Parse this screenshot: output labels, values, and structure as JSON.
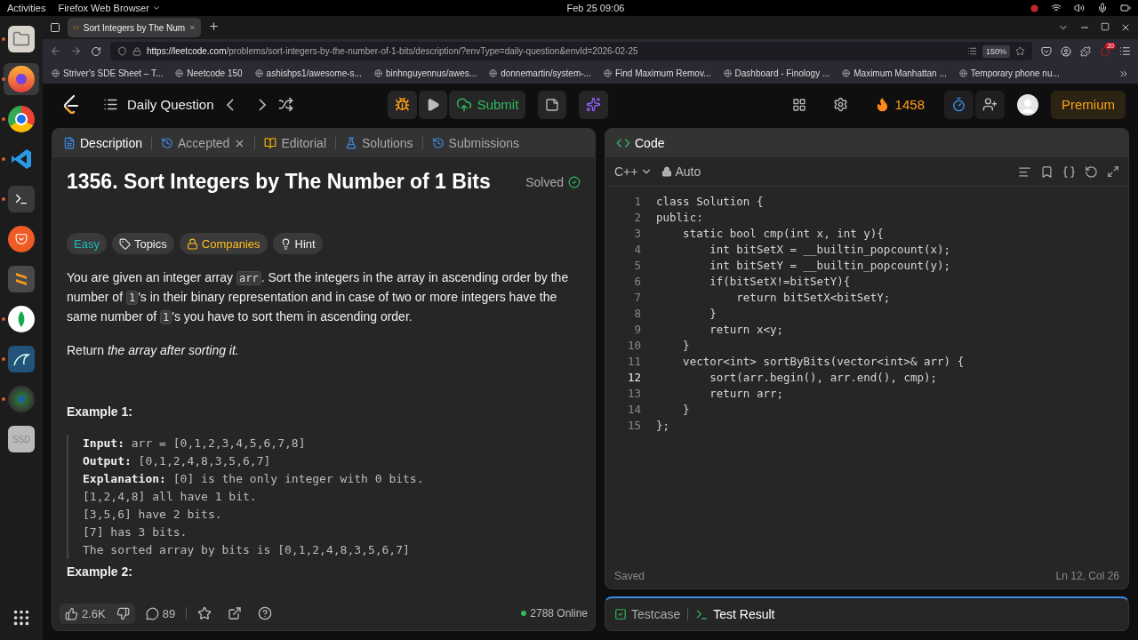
{
  "system_bar": {
    "activities": "Activities",
    "app_menu": "Firefox Web Browser",
    "clock": "Feb 25  09:06"
  },
  "dock": [
    {
      "kind": "files",
      "running": true,
      "selected": false
    },
    {
      "kind": "firefox",
      "running": true,
      "selected": true
    },
    {
      "kind": "chrome",
      "running": true,
      "selected": false
    },
    {
      "kind": "vscode",
      "running": true,
      "selected": false
    },
    {
      "kind": "terminal",
      "running": true,
      "selected": false
    },
    {
      "kind": "postman",
      "running": false,
      "selected": false
    },
    {
      "kind": "sublime",
      "running": false,
      "selected": false
    },
    {
      "kind": "mongodb",
      "running": true,
      "selected": false
    },
    {
      "kind": "mysql",
      "running": true,
      "selected": false
    },
    {
      "kind": "camera",
      "running": true,
      "selected": false
    },
    {
      "kind": "disk",
      "label": "SSD",
      "running": false,
      "selected": false
    }
  ],
  "browser": {
    "tab_title": "Sort Integers by The Num",
    "url_host": "https://leetcode.com",
    "url_path": "/problems/sort-integers-by-the-number-of-1-bits/description/?envType=daily-question&envId=2026-02-25",
    "zoom": "150%",
    "extension_badge": "20",
    "bookmarks": [
      "Striver's SDE Sheet – T...",
      "Neetcode 150",
      "ashishps1/awesome-s...",
      "binhnguyennus/awes...",
      "donnemartin/system-...",
      "Find Maximum Remov...",
      "Dashboard - Finology ...",
      "Maximum Manhattan ...",
      "Temporary phone nu..."
    ]
  },
  "header": {
    "title": "Daily Question",
    "submit": "Submit",
    "streak": "1458",
    "premium": "Premium"
  },
  "left_tabs": [
    {
      "label": "Description",
      "kind": "description",
      "selected": true
    },
    {
      "label": "Accepted",
      "kind": "accepted",
      "selected": false
    },
    {
      "label": "Editorial",
      "kind": "editorial",
      "selected": false
    },
    {
      "label": "Solutions",
      "kind": "solutions",
      "selected": false
    },
    {
      "label": "Submissions",
      "kind": "submissions",
      "selected": false
    }
  ],
  "problem": {
    "title": "1356. Sort Integers by The Number of 1 Bits",
    "status": "Solved",
    "tags": [
      {
        "label": "Easy",
        "kind": "difficulty"
      },
      {
        "label": "Topics",
        "kind": "topics"
      },
      {
        "label": "Companies",
        "kind": "companies"
      },
      {
        "label": "Hint",
        "kind": "hint"
      }
    ],
    "description": [
      {
        "kind": "text",
        "text": "You are given an integer array "
      },
      {
        "kind": "code",
        "text": "arr"
      },
      {
        "kind": "text",
        "text": ". Sort the integers in the array in ascending order by the number of "
      },
      {
        "kind": "code",
        "text": "1"
      },
      {
        "kind": "text",
        "text": "'s in their binary representation and in case of two or more integers have the same number of "
      },
      {
        "kind": "code",
        "text": "1"
      },
      {
        "kind": "text",
        "text": "'s you have to sort them in ascending order."
      }
    ],
    "return_text": "Return *the array after sorting it.*",
    "example_title": "Example 1:",
    "example_lines": [
      "**Input:** arr = [0,1,2,3,4,5,6,7,8]",
      "**Output:** [0,1,2,4,8,3,5,6,7]",
      "**Explanation:** [0] is the only integer with 0 bits.",
      "[1,2,4,8] all have 1 bit.",
      "[3,5,6] have 2 bits.",
      "[7] has 3 bits.",
      "The sorted array by bits is [0,1,2,4,8,3,5,6,7]"
    ],
    "next_example": "Example 2:"
  },
  "footer": {
    "likes": "2.6K",
    "comments": "89",
    "online": "2788 Online"
  },
  "code_panel": {
    "title": "Code",
    "language": "C++",
    "mode": "Auto",
    "status": "Saved",
    "cursor": "Ln 12, Col 26",
    "lines": [
      {
        "number": "1",
        "text": "class Solution {",
        "current": false
      },
      {
        "number": "2",
        "text": "public:",
        "current": false
      },
      {
        "number": "3",
        "text": "    static bool cmp(int x, int y){",
        "current": false
      },
      {
        "number": "4",
        "text": "        int bitSetX = __builtin_popcount(x);",
        "current": false
      },
      {
        "number": "5",
        "text": "        int bitSetY = __builtin_popcount(y);",
        "current": false
      },
      {
        "number": "6",
        "text": "        if(bitSetX!=bitSetY){",
        "current": false
      },
      {
        "number": "7",
        "text": "            return bitSetX<bitSetY;",
        "current": false
      },
      {
        "number": "8",
        "text": "        }",
        "current": false
      },
      {
        "number": "9",
        "text": "        return x<y;",
        "current": false
      },
      {
        "number": "10",
        "text": "    }",
        "current": false
      },
      {
        "number": "11",
        "text": "    vector<int> sortByBits(vector<int>& arr) {",
        "current": false
      },
      {
        "number": "12",
        "text": "        sort(arr.begin(), arr.end(), cmp);",
        "current": true
      },
      {
        "number": "13",
        "text": "        return arr;",
        "current": false
      },
      {
        "number": "14",
        "text": "    }",
        "current": false
      },
      {
        "number": "15",
        "text": "};",
        "current": false
      }
    ]
  },
  "bottom_tabs": [
    {
      "label": "Testcase",
      "kind": "testcase",
      "selected": false
    },
    {
      "label": "Test Result",
      "kind": "result",
      "selected": true
    }
  ]
}
